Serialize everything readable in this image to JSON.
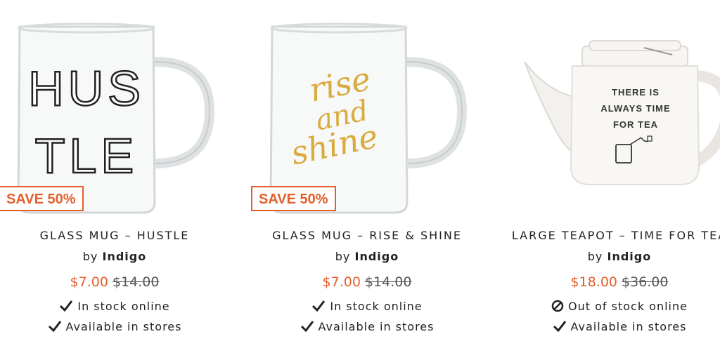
{
  "products": [
    {
      "name": "GLASS MUG – HUSTLE",
      "by_prefix": "by",
      "brand": "Indigo",
      "badge": "SAVE 50%",
      "sale_price": "$7.00",
      "original_price": "$14.00",
      "online_status": "In stock online",
      "store_status": "Available in stores",
      "mug_text_line1": "HUS",
      "mug_text_line2": "TLE"
    },
    {
      "name": "GLASS MUG – RISE & SHINE",
      "by_prefix": "by",
      "brand": "Indigo",
      "badge": "SAVE 50%",
      "sale_price": "$7.00",
      "original_price": "$14.00",
      "online_status": "In stock online",
      "store_status": "Available in stores",
      "mug_text_line1": "rise",
      "mug_text_line2": "and",
      "mug_text_line3": "shine"
    },
    {
      "name": "LARGE TEAPOT – TIME FOR TEA",
      "by_prefix": "by",
      "brand": "Indigo",
      "sale_price": "$18.00",
      "original_price": "$36.00",
      "online_status": "Out of stock online",
      "store_status": "Available in stores",
      "pot_text_line1": "THERE IS",
      "pot_text_line2": "ALWAYS TIME",
      "pot_text_line3": "FOR TEA"
    }
  ],
  "colors": {
    "accent": "#e35f2b",
    "gold": "#d9ab3f"
  },
  "icons": {
    "in_stock": "check-icon",
    "out_of_stock": "unavailable-icon"
  }
}
